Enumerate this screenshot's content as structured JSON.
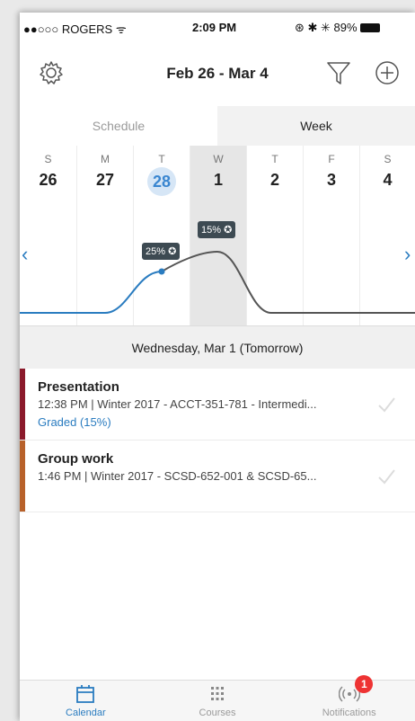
{
  "status_bar": {
    "carrier": "●●○○○ ROGERS ᯤ",
    "time": "2:09 PM",
    "right": "⊛ ✱ ✳ 89%"
  },
  "header": {
    "title": "Feb 26 - Mar 4",
    "settings_icon": "gear-icon",
    "filter_icon": "filter-icon",
    "add_icon": "plus-circle-icon"
  },
  "tabs": [
    {
      "label": "Schedule",
      "active": false
    },
    {
      "label": "Week",
      "active": true
    }
  ],
  "week": {
    "days": [
      {
        "dow": "S",
        "num": "26"
      },
      {
        "dow": "M",
        "num": "27"
      },
      {
        "dow": "T",
        "num": "28",
        "today": true
      },
      {
        "dow": "W",
        "num": "1",
        "selected": true
      },
      {
        "dow": "T",
        "num": "2"
      },
      {
        "dow": "F",
        "num": "3"
      },
      {
        "dow": "S",
        "num": "4"
      }
    ],
    "bubbles": [
      "25%",
      "15%"
    ]
  },
  "date_header": "Wednesday, Mar 1 (Tomorrow)",
  "events": [
    {
      "name": "Presentation",
      "meta": "12:38 PM | Winter 2017 - ACCT-351-781 - Intermedi...",
      "graded": "Graded (15%)",
      "color": "#8b1a2b"
    },
    {
      "name": "Group work",
      "meta": "1:46 PM | Winter 2017 - SCSD-652-001 & SCSD-65...",
      "graded": "",
      "color": "#b8612a"
    }
  ],
  "bottom_tabs": [
    {
      "label": "Calendar",
      "icon": "calendar-icon",
      "active": true
    },
    {
      "label": "Courses",
      "icon": "grid-icon",
      "active": false
    },
    {
      "label": "Notifications",
      "icon": "broadcast-icon",
      "active": false,
      "badge": "1"
    }
  ],
  "colors": {
    "accent": "#2a7cc0",
    "selected_day": "#e6e6e6"
  }
}
